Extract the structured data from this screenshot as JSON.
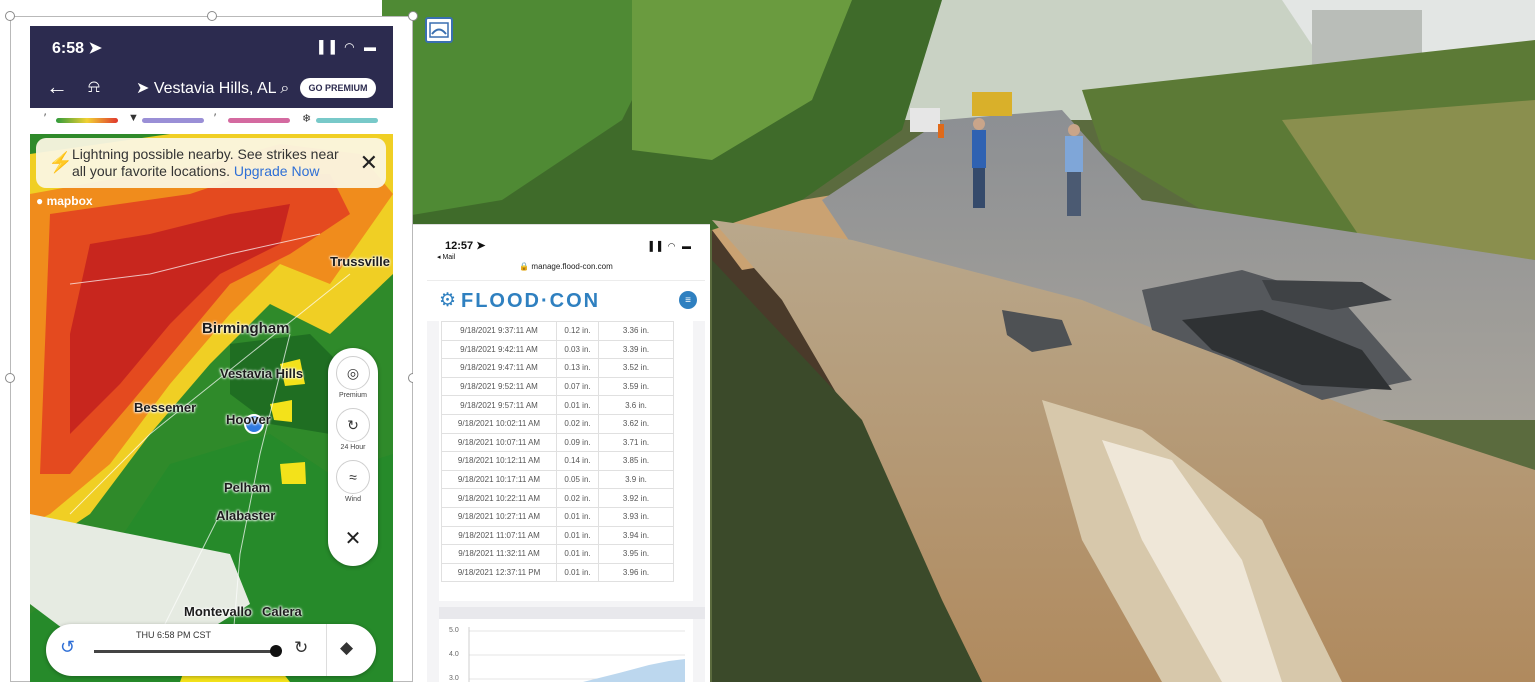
{
  "weather_app": {
    "status_time": "6:58 ➤",
    "status_icons": "▐▐ ◠ ▬",
    "nav": {
      "back_icon": "←",
      "bell_icon": "⍾",
      "location": "➤ Vestavia Hills, AL ⌕",
      "go_premium": "GO PREMIUM"
    },
    "legend": {
      "rain_icon": "′",
      "hail_icon": "▼",
      "mix_icon": "′",
      "snow_icon": "❄",
      "colors": [
        "#2f9a3b",
        "#f1d133",
        "#e0362d",
        "#9a8fd6",
        "#d46aa0",
        "#78c9c9"
      ]
    },
    "banner": {
      "icon": "⚡",
      "text": "Lightning possible nearby. See strikes near all your favorite locations.",
      "link": "Upgrade Now",
      "close": "✕"
    },
    "mapbox": "● mapbox",
    "map_labels": {
      "trussville": "Trussville",
      "birmingham": "Birmingham",
      "vestavia": "Vestavia Hills",
      "bessemer": "Bessemer",
      "hoover": "Hoover",
      "pelham": "Pelham",
      "alabaster": "Alabaster",
      "montevallo": "Montevallo",
      "calera": "Calera"
    },
    "controls": {
      "premium_icon": "◎",
      "premium_label": "Premium",
      "hour_icon": "↻",
      "hour_label": "24 Hour",
      "wind_icon": "≈",
      "wind_label": "Wind",
      "close_icon": "✕"
    },
    "timeline": {
      "time": "THU 6:58 PM CST",
      "replay_icon": "↺",
      "clock_icon": "↻",
      "layers_icon": "◆"
    }
  },
  "floodcon": {
    "status_time": "12:57 ➤",
    "back_label": "◂ Mail",
    "status_icons": "▐▐ ◠ ▬",
    "url": "🔒 manage.flood-con.com",
    "logo": "FLOOD·CON",
    "gear_icon": "⚙",
    "menu_icon": "≡",
    "rows": [
      {
        "date": "9/18/2021 9:37:11 AM",
        "inc": "0.12 in.",
        "total": "3.36 in."
      },
      {
        "date": "9/18/2021 9:42:11 AM",
        "inc": "0.03 in.",
        "total": "3.39 in."
      },
      {
        "date": "9/18/2021 9:47:11 AM",
        "inc": "0.13 in.",
        "total": "3.52 in."
      },
      {
        "date": "9/18/2021 9:52:11 AM",
        "inc": "0.07 in.",
        "total": "3.59 in."
      },
      {
        "date": "9/18/2021 9:57:11 AM",
        "inc": "0.01 in.",
        "total": "3.6 in."
      },
      {
        "date": "9/18/2021 10:02:11 AM",
        "inc": "0.02 in.",
        "total": "3.62 in."
      },
      {
        "date": "9/18/2021 10:07:11 AM",
        "inc": "0.09 in.",
        "total": "3.71 in."
      },
      {
        "date": "9/18/2021 10:12:11 AM",
        "inc": "0.14 in.",
        "total": "3.85 in."
      },
      {
        "date": "9/18/2021 10:17:11 AM",
        "inc": "0.05 in.",
        "total": "3.9 in."
      },
      {
        "date": "9/18/2021 10:22:11 AM",
        "inc": "0.02 in.",
        "total": "3.92 in."
      },
      {
        "date": "9/18/2021 10:27:11 AM",
        "inc": "0.01 in.",
        "total": "3.93 in."
      },
      {
        "date": "9/18/2021 11:07:11 AM",
        "inc": "0.01 in.",
        "total": "3.94 in."
      },
      {
        "date": "9/18/2021 11:32:11 AM",
        "inc": "0.01 in.",
        "total": "3.95 in."
      },
      {
        "date": "9/18/2021 12:37:11 PM",
        "inc": "0.01 in.",
        "total": "3.96 in."
      }
    ],
    "chart_ticks": [
      "5.0",
      "4.0",
      "3.0"
    ]
  },
  "photo": {
    "icon": "picture-icon"
  }
}
